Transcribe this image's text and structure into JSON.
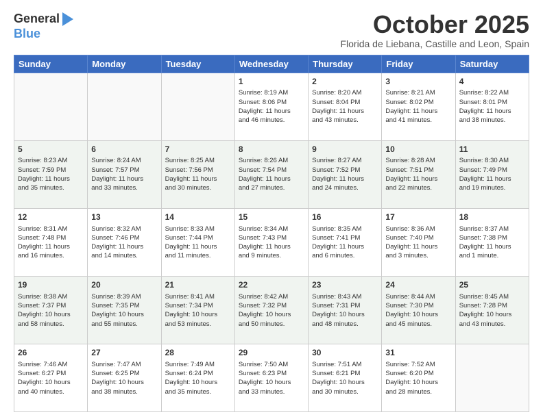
{
  "logo": {
    "general": "General",
    "blue": "Blue"
  },
  "title": "October 2025",
  "subtitle": "Florida de Liebana, Castille and Leon, Spain",
  "days": [
    "Sunday",
    "Monday",
    "Tuesday",
    "Wednesday",
    "Thursday",
    "Friday",
    "Saturday"
  ],
  "weeks": [
    [
      {
        "day": "",
        "info": ""
      },
      {
        "day": "",
        "info": ""
      },
      {
        "day": "",
        "info": ""
      },
      {
        "day": "1",
        "info": "Sunrise: 8:19 AM\nSunset: 8:06 PM\nDaylight: 11 hours\nand 46 minutes."
      },
      {
        "day": "2",
        "info": "Sunrise: 8:20 AM\nSunset: 8:04 PM\nDaylight: 11 hours\nand 43 minutes."
      },
      {
        "day": "3",
        "info": "Sunrise: 8:21 AM\nSunset: 8:02 PM\nDaylight: 11 hours\nand 41 minutes."
      },
      {
        "day": "4",
        "info": "Sunrise: 8:22 AM\nSunset: 8:01 PM\nDaylight: 11 hours\nand 38 minutes."
      }
    ],
    [
      {
        "day": "5",
        "info": "Sunrise: 8:23 AM\nSunset: 7:59 PM\nDaylight: 11 hours\nand 35 minutes."
      },
      {
        "day": "6",
        "info": "Sunrise: 8:24 AM\nSunset: 7:57 PM\nDaylight: 11 hours\nand 33 minutes."
      },
      {
        "day": "7",
        "info": "Sunrise: 8:25 AM\nSunset: 7:56 PM\nDaylight: 11 hours\nand 30 minutes."
      },
      {
        "day": "8",
        "info": "Sunrise: 8:26 AM\nSunset: 7:54 PM\nDaylight: 11 hours\nand 27 minutes."
      },
      {
        "day": "9",
        "info": "Sunrise: 8:27 AM\nSunset: 7:52 PM\nDaylight: 11 hours\nand 24 minutes."
      },
      {
        "day": "10",
        "info": "Sunrise: 8:28 AM\nSunset: 7:51 PM\nDaylight: 11 hours\nand 22 minutes."
      },
      {
        "day": "11",
        "info": "Sunrise: 8:30 AM\nSunset: 7:49 PM\nDaylight: 11 hours\nand 19 minutes."
      }
    ],
    [
      {
        "day": "12",
        "info": "Sunrise: 8:31 AM\nSunset: 7:48 PM\nDaylight: 11 hours\nand 16 minutes."
      },
      {
        "day": "13",
        "info": "Sunrise: 8:32 AM\nSunset: 7:46 PM\nDaylight: 11 hours\nand 14 minutes."
      },
      {
        "day": "14",
        "info": "Sunrise: 8:33 AM\nSunset: 7:44 PM\nDaylight: 11 hours\nand 11 minutes."
      },
      {
        "day": "15",
        "info": "Sunrise: 8:34 AM\nSunset: 7:43 PM\nDaylight: 11 hours\nand 9 minutes."
      },
      {
        "day": "16",
        "info": "Sunrise: 8:35 AM\nSunset: 7:41 PM\nDaylight: 11 hours\nand 6 minutes."
      },
      {
        "day": "17",
        "info": "Sunrise: 8:36 AM\nSunset: 7:40 PM\nDaylight: 11 hours\nand 3 minutes."
      },
      {
        "day": "18",
        "info": "Sunrise: 8:37 AM\nSunset: 7:38 PM\nDaylight: 11 hours\nand 1 minute."
      }
    ],
    [
      {
        "day": "19",
        "info": "Sunrise: 8:38 AM\nSunset: 7:37 PM\nDaylight: 10 hours\nand 58 minutes."
      },
      {
        "day": "20",
        "info": "Sunrise: 8:39 AM\nSunset: 7:35 PM\nDaylight: 10 hours\nand 55 minutes."
      },
      {
        "day": "21",
        "info": "Sunrise: 8:41 AM\nSunset: 7:34 PM\nDaylight: 10 hours\nand 53 minutes."
      },
      {
        "day": "22",
        "info": "Sunrise: 8:42 AM\nSunset: 7:32 PM\nDaylight: 10 hours\nand 50 minutes."
      },
      {
        "day": "23",
        "info": "Sunrise: 8:43 AM\nSunset: 7:31 PM\nDaylight: 10 hours\nand 48 minutes."
      },
      {
        "day": "24",
        "info": "Sunrise: 8:44 AM\nSunset: 7:30 PM\nDaylight: 10 hours\nand 45 minutes."
      },
      {
        "day": "25",
        "info": "Sunrise: 8:45 AM\nSunset: 7:28 PM\nDaylight: 10 hours\nand 43 minutes."
      }
    ],
    [
      {
        "day": "26",
        "info": "Sunrise: 7:46 AM\nSunset: 6:27 PM\nDaylight: 10 hours\nand 40 minutes."
      },
      {
        "day": "27",
        "info": "Sunrise: 7:47 AM\nSunset: 6:25 PM\nDaylight: 10 hours\nand 38 minutes."
      },
      {
        "day": "28",
        "info": "Sunrise: 7:49 AM\nSunset: 6:24 PM\nDaylight: 10 hours\nand 35 minutes."
      },
      {
        "day": "29",
        "info": "Sunrise: 7:50 AM\nSunset: 6:23 PM\nDaylight: 10 hours\nand 33 minutes."
      },
      {
        "day": "30",
        "info": "Sunrise: 7:51 AM\nSunset: 6:21 PM\nDaylight: 10 hours\nand 30 minutes."
      },
      {
        "day": "31",
        "info": "Sunrise: 7:52 AM\nSunset: 6:20 PM\nDaylight: 10 hours\nand 28 minutes."
      },
      {
        "day": "",
        "info": ""
      }
    ]
  ]
}
